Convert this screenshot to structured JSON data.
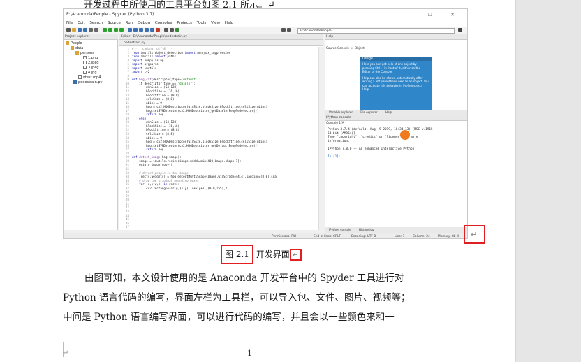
{
  "document": {
    "top_line_fragment": "开发过程中所使用的工具平台如图 2.1 所示。↵",
    "figure_caption": {
      "number": "图 2.1",
      "title": "开发界面",
      "para_mark": "↵"
    },
    "paragraph_lines": [
      "由图可知，本文设计使用的是 Anaconda 开发平台中的 Spyder 工具进行对",
      "Python 语言代码的编写，界面左栏为工具栏，可以导入包、文件、图片、视频等；",
      "中间是 Python 语言编写界面，可以进行代码的编写，并且会以一些颜色来和一"
    ],
    "page_number": "1",
    "footer_para_mark": "↵"
  },
  "screenshot": {
    "window_title": "E:\\Acanonda\\People - Spyder (Python 3.7)",
    "window_controls": "—  ☐  ✕",
    "menu_items": [
      "File",
      "Edit",
      "Search",
      "Source",
      "Run",
      "Debug",
      "Consoles",
      "Projects",
      "Tools",
      "View",
      "Help"
    ],
    "path_field": "E:\\Acanonda\\People",
    "project_explorer": {
      "header": "Project explorer",
      "items": [
        {
          "label": "People",
          "level": 0,
          "type": "folder"
        },
        {
          "label": "data",
          "level": 1,
          "type": "folder"
        },
        {
          "label": "persons",
          "level": 2,
          "type": "folder"
        },
        {
          "label": "1.png",
          "level": 3,
          "type": "file"
        },
        {
          "label": "2.jpeg",
          "level": 3,
          "type": "file"
        },
        {
          "label": "3.jpeg",
          "level": 3,
          "type": "file"
        },
        {
          "label": "4.jpg",
          "level": 3,
          "type": "file"
        },
        {
          "label": "vtest.mp4",
          "level": 2,
          "type": "file"
        },
        {
          "label": "pedestrain.py",
          "level": 1,
          "type": "file"
        }
      ]
    },
    "editor": {
      "header": "Editor - E:\\Acanonda\\People\\pedestrain.py",
      "tab": "pedestrain.py"
    },
    "help": {
      "header": "Help",
      "source_label": "Source Console",
      "object_label": "Object",
      "card_title": "Usage",
      "card_text_1": "Here you can get help of any object by pressing Ctrl+I in front of it, either on the Editor or the Console.",
      "card_text_2": "Help can also be shown automatically after writing a left parenthesis next to an object. You can activate this behavior in Preferences > Help.",
      "tabs": [
        "Variable explorer",
        "File explorer",
        "Help"
      ]
    },
    "console": {
      "header": "IPython console",
      "tab": "Console 1/A",
      "lines": [
        "Python 3.7.4 (default, Aug  9 2019, 18:34:13) [MSC v.1915",
        "64 bit (AMD64)]",
        "Type \"copyright\", \"credits\" or \"license\" for more",
        "information.",
        "",
        "IPython 7.8.0 -- An enhanced Interactive Python.",
        ""
      ],
      "prompt": "In [1]:",
      "tabs": [
        "IPython console",
        "History log"
      ]
    },
    "status_bar": {
      "permissions": "Permissions: RW",
      "eol": "End-of-lines: CRLF",
      "encoding": "Encoding: UTF-8",
      "line": "Line: 1",
      "column": "Column: 24",
      "memory": "Memory: 88 %"
    }
  }
}
